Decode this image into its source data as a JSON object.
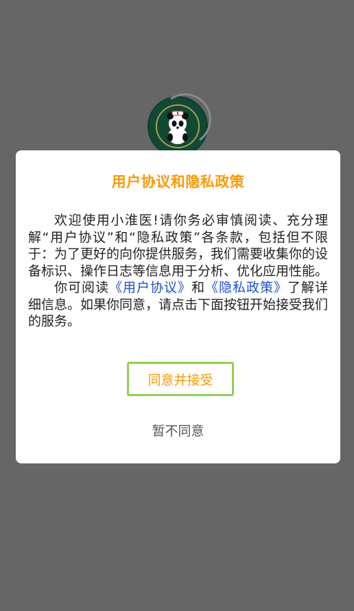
{
  "splash": {
    "logo_icon": "panda-doctor-logo-icon"
  },
  "dialog": {
    "title": "用户协议和隐私政策",
    "p1": "欢迎使用小淮医!请你务必审慎阅读、充分理解“用户协议”和“隐私政策”各条款，包括但不限于：为了更好的向你提供服务，我们需要收集你的设备标识、操作日志等信息用于分析、优化应用性能。",
    "p2_prefix": "你可阅读",
    "link_user_agreement": "《用户协议》",
    "p2_and": "和",
    "link_privacy_policy": "《隐私政策》",
    "p2_suffix": "了解详细信息。如果你同意，请点击下面按钮开始接受我们的服务。",
    "agree_label": "同意并接受",
    "decline_label": "暂不同意"
  },
  "colors": {
    "overlay": "#666666",
    "title": "#ff9900",
    "link": "#1a4fd6",
    "agree_border": "#8fd14f"
  }
}
